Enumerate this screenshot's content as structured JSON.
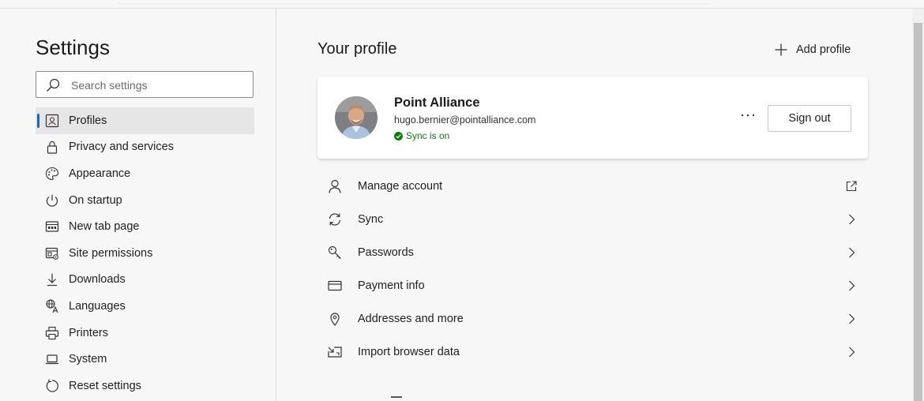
{
  "sidebar": {
    "title": "Settings",
    "search_placeholder": "Search settings",
    "items": [
      {
        "label": "Profiles",
        "icon": "profile-card-icon",
        "active": true
      },
      {
        "label": "Privacy and services",
        "icon": "lock-icon"
      },
      {
        "label": "Appearance",
        "icon": "palette-icon"
      },
      {
        "label": "On startup",
        "icon": "power-icon"
      },
      {
        "label": "New tab page",
        "icon": "new-tab-icon"
      },
      {
        "label": "Site permissions",
        "icon": "site-permissions-icon"
      },
      {
        "label": "Downloads",
        "icon": "download-icon"
      },
      {
        "label": "Languages",
        "icon": "languages-icon"
      },
      {
        "label": "Printers",
        "icon": "printer-icon"
      },
      {
        "label": "System",
        "icon": "laptop-icon"
      },
      {
        "label": "Reset settings",
        "icon": "reset-icon"
      }
    ]
  },
  "main": {
    "title": "Your profile",
    "add_profile_label": "Add profile",
    "profile": {
      "name": "Point Alliance",
      "email": "hugo.bernier@pointalliance.com",
      "sync_status": "Sync is on",
      "sign_out_label": "Sign out"
    },
    "rows": [
      {
        "label": "Manage account",
        "icon": "person-icon",
        "trailing": "external-link-icon"
      },
      {
        "label": "Sync",
        "icon": "sync-icon",
        "trailing": "chevron-right-icon"
      },
      {
        "label": "Passwords",
        "icon": "key-icon",
        "trailing": "chevron-right-icon"
      },
      {
        "label": "Payment info",
        "icon": "credit-card-icon",
        "trailing": "chevron-right-icon"
      },
      {
        "label": "Addresses and more",
        "icon": "location-pin-icon",
        "trailing": "chevron-right-icon"
      },
      {
        "label": "Import browser data",
        "icon": "import-icon",
        "trailing": "chevron-right-icon"
      }
    ]
  },
  "colors": {
    "accent": "#0f6cbd",
    "sync_green": "#107c10"
  }
}
